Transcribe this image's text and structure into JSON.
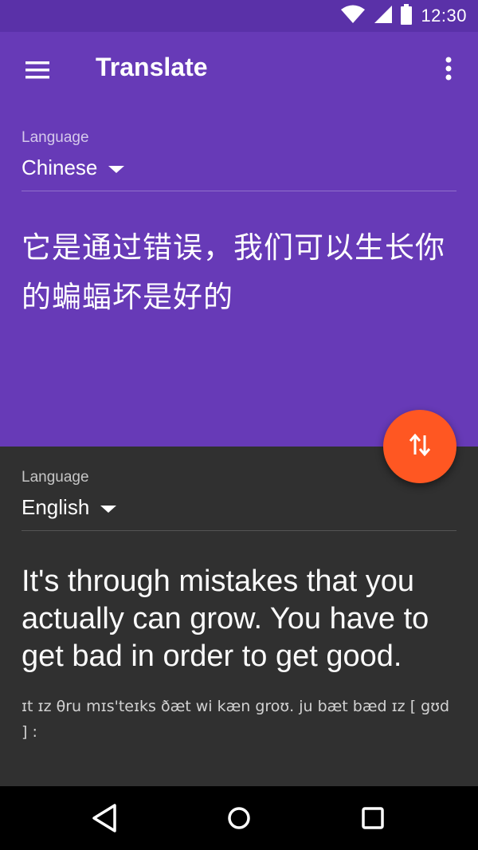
{
  "status_bar": {
    "time": "12:30",
    "icons": [
      "wifi-icon",
      "cell-signal-icon",
      "battery-icon"
    ]
  },
  "app_bar": {
    "title": "Translate",
    "menu_icon": "hamburger-menu-icon",
    "overflow_icon": "more-vert-icon"
  },
  "source": {
    "language_label": "Language",
    "language": "Chinese",
    "text": "它是通过错误，我们可以生长你的蝙蝠坏是好的"
  },
  "target": {
    "language_label": "Language",
    "language": "English",
    "text": "It's through mistakes that you actually can grow. You have to get bad in order to get good.",
    "phonetic": "ɪt ɪz θru mɪs'teɪks ðæt wi kæn groʊ. ju bæt bæd ɪz [ gʊd ] :"
  },
  "fab": {
    "icon": "swap-vertical-icon"
  },
  "nav_bar": {
    "icons": [
      "back-icon",
      "home-icon",
      "recents-icon"
    ]
  },
  "colors": {
    "status_bar": "#5a31a8",
    "primary": "#673ab7",
    "dark_panel": "#303030",
    "accent": "#ff5722"
  }
}
